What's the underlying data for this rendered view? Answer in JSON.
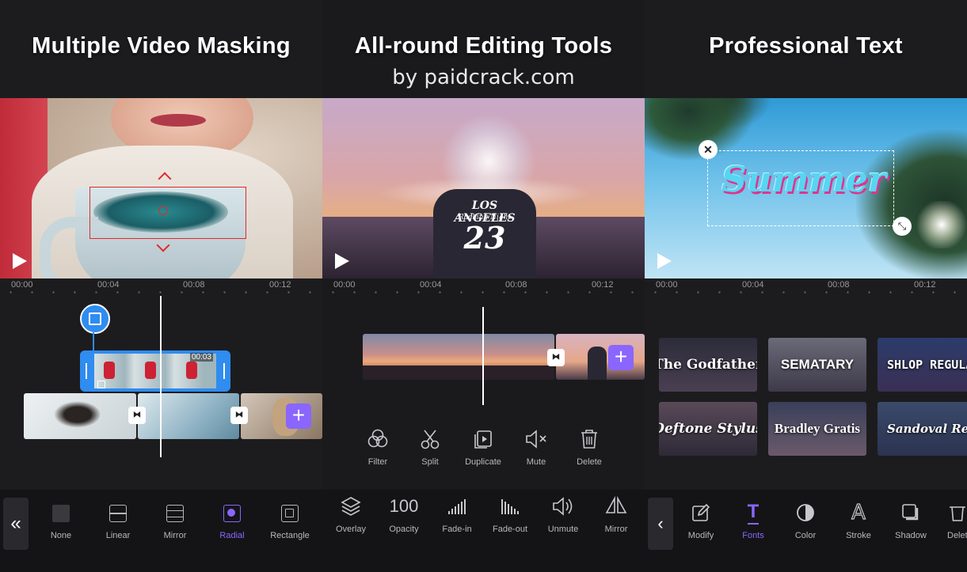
{
  "watermark": "by paidcrack.com",
  "colors": {
    "accent": "#8a66ff",
    "clip_selected": "#2f8cf0",
    "mask_rect": "#e02a2a"
  },
  "panel1": {
    "title": "Multiple Video Masking",
    "ruler": [
      "00:00",
      "00:04",
      "00:08",
      "00:12"
    ],
    "clip_duration": "00:03",
    "toolbar": [
      {
        "label": "None",
        "icon": "none-mask-icon",
        "active": false
      },
      {
        "label": "Linear",
        "icon": "linear-mask-icon",
        "active": false
      },
      {
        "label": "Mirror",
        "icon": "mirror-mask-icon",
        "active": false
      },
      {
        "label": "Radial",
        "icon": "radial-mask-icon",
        "active": true
      },
      {
        "label": "Rectangle",
        "icon": "rectangle-mask-icon",
        "active": false
      }
    ]
  },
  "panel2": {
    "title": "All-round Editing Tools",
    "ruler": [
      "00:00",
      "00:04",
      "00:08",
      "00:12"
    ],
    "photo_shirt_text": "LOS ANGELES",
    "photo_shirt_sub": "Racking Night",
    "photo_shirt_number": "23",
    "actions": [
      "Filter",
      "Split",
      "Duplicate",
      "Mute",
      "Delete"
    ],
    "toolbar": [
      {
        "label": "Overlay",
        "icon": "overlay-icon"
      },
      {
        "label": "Opacity",
        "icon": "opacity-value",
        "value": "100"
      },
      {
        "label": "Fade-in",
        "icon": "fade-in-icon"
      },
      {
        "label": "Fade-out",
        "icon": "fade-out-icon"
      },
      {
        "label": "Unmute",
        "icon": "unmute-icon"
      },
      {
        "label": "Mirror",
        "icon": "mirror-icon"
      }
    ]
  },
  "panel3": {
    "title": "Professional Text",
    "ruler": [
      "00:00",
      "00:04",
      "00:08",
      "00:12"
    ],
    "sticker_text": "Summer",
    "fonts": [
      "The Godfather",
      "SEMATARY",
      "SHLOP REGULAR",
      "Deftone Stylus",
      "Bradley Gratis",
      "Sandoval Regular"
    ],
    "toolbar": [
      {
        "label": "Modify",
        "icon": "modify-icon",
        "active": false
      },
      {
        "label": "Fonts",
        "icon": "fonts-icon",
        "active": true
      },
      {
        "label": "Color",
        "icon": "color-icon",
        "active": false
      },
      {
        "label": "Stroke",
        "icon": "stroke-icon",
        "active": false
      },
      {
        "label": "Shadow",
        "icon": "shadow-icon",
        "active": false
      },
      {
        "label": "Delete",
        "icon": "delete-icon",
        "active": false
      }
    ]
  }
}
